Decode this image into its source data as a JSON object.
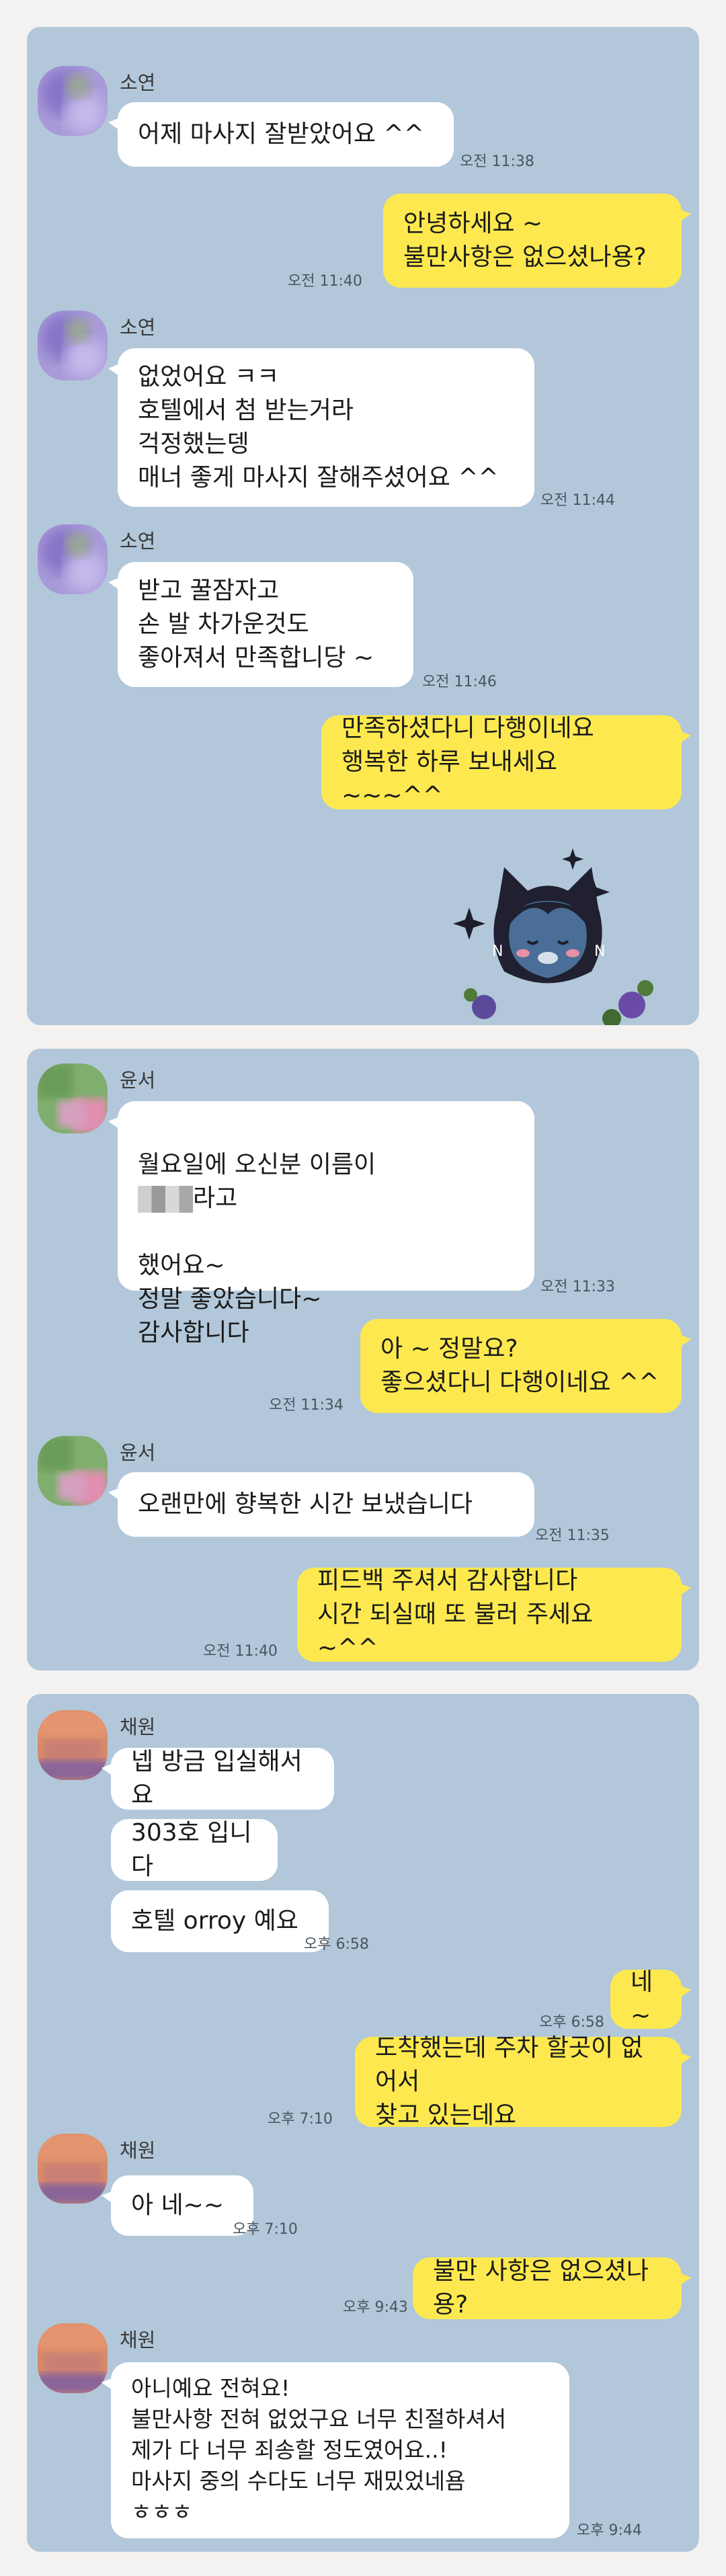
{
  "panel1": {
    "sender": "소연",
    "m1": "어제 마사지 잘받았어요 ^^",
    "t1": "오전 11:38",
    "m2": "안녕하세요 ~\n불만사항은 없으셨나용?",
    "t2": "오전 11:40",
    "m3": "없었어요 ㅋㅋ\n호텔에서 첨 받는거라\n걱정했는뎅\n매너 좋게 마사지 잘해주셨어요 ^^",
    "t3": "오전 11:44",
    "m4": "받고 꿀잠자고\n손 발 차가운것도\n좋아져서 만족합니당 ~",
    "t4": "오전 11:46",
    "m5": "만족하셨다니 다행이네요\n행복한 하루 보내세요 ~~~^^"
  },
  "panel2": {
    "sender": "윤서",
    "m1_a": "월요일에 오신분 이름이",
    "m1_b": "라고",
    "m1_c": "했어요~\n정말 좋았습니다~\n감사합니다",
    "t1": "오전 11:33",
    "m2": "아 ~ 정말요?\n좋으셨다니 다행이네요 ^^",
    "t2": "오전 11:34",
    "m3": "오랜만에 향복한 시간 보냈습니다",
    "t3": "오전 11:35",
    "m4": "피드백 주셔서 감사합니다\n시간 되실때 또 불러 주세요 ~^^",
    "t4": "오전 11:40"
  },
  "panel3": {
    "sender": "채원",
    "m1": "넵 방금 입실해서요",
    "m2": "303호 입니다",
    "m3": "호텔 orroy 예요",
    "t3": "오후 6:58",
    "m4": "네 ~",
    "t4": "오후 6:58",
    "m5": "도착했는데  주차 할곳이 없어서\n찾고 있는데요",
    "t5": "오후 7:10",
    "m6": "아 네~~",
    "t6": "오후 7:10",
    "m7": "불만 사항은 없으셨나용?",
    "t7": "오후 9:43",
    "m8": "아니예요 전혀요!\n불만사항 전혀 없었구요 너무 친절하셔서\n제가 다 너무 죄송할 정도였어요..!\n마사지 중의 수다도 너무 재밌었네욤\nㅎㅎㅎ",
    "t8": "오후 9:44"
  },
  "colors": {
    "background": "#b2c7da",
    "incoming": "#ffffff",
    "outgoing": "#fde94f"
  },
  "icons": {
    "avatar_1": "blurred-purple-avatar",
    "avatar_2": "blurred-green-pink-avatar",
    "avatar_3": "blurred-peach-purple-avatar",
    "sticker": "kakao-character-sticker"
  }
}
